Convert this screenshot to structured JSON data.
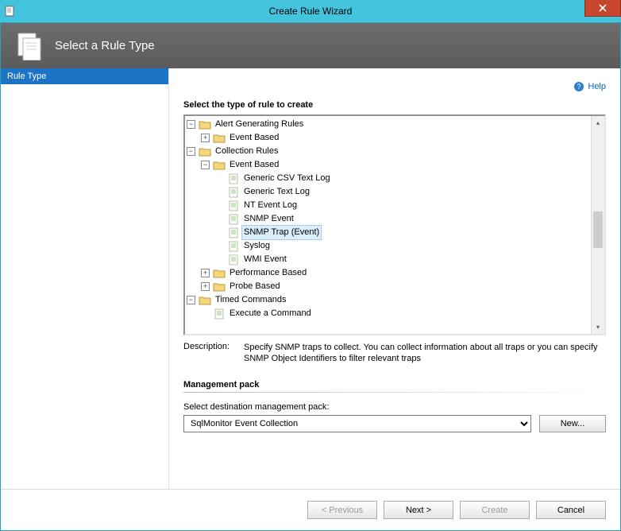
{
  "window": {
    "title": "Create Rule Wizard",
    "subtitle": "Select a Rule Type"
  },
  "sidebar": {
    "steps": [
      "Rule Type"
    ]
  },
  "help": {
    "label": "Help"
  },
  "section": {
    "title": "Select the type of rule to create"
  },
  "tree": {
    "alert_generating": "Alert Generating Rules",
    "alert_event_based": "Event Based",
    "collection_rules": "Collection Rules",
    "coll_event_based": "Event Based",
    "generic_csv": "Generic CSV Text Log",
    "generic_text": "Generic Text Log",
    "nt_event_log": "NT Event Log",
    "snmp_event": "SNMP Event",
    "snmp_trap": "SNMP Trap (Event)",
    "syslog": "Syslog",
    "wmi_event": "WMI Event",
    "perf_based": "Performance Based",
    "probe_based": "Probe Based",
    "timed_commands": "Timed Commands",
    "execute_cmd": "Execute a Command"
  },
  "description": {
    "label": "Description:",
    "text": "Specify SNMP traps to collect. You can collect information about all traps or you can specify SNMP Object Identifiers to filter relevant traps"
  },
  "management_pack": {
    "title": "Management pack",
    "caption": "Select destination management pack:",
    "selected": "SqlMonitor Event Collection",
    "new_label": "New..."
  },
  "nav": {
    "previous": "< Previous",
    "next": "Next >",
    "create": "Create",
    "cancel": "Cancel"
  }
}
